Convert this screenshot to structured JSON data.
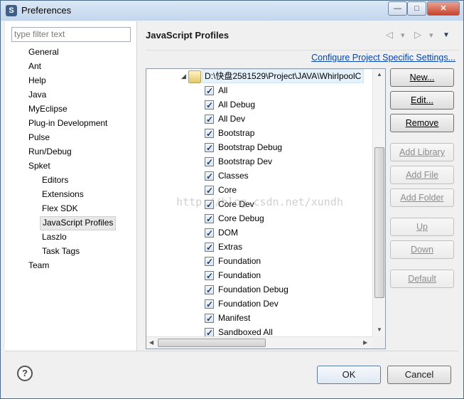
{
  "window": {
    "title": "Preferences",
    "controls": {
      "minimize": "—",
      "maximize": "□",
      "close": "✕"
    }
  },
  "filter": {
    "placeholder": "type filter text"
  },
  "nav": {
    "items": [
      {
        "label": "General",
        "level": 0
      },
      {
        "label": "Ant",
        "level": 0
      },
      {
        "label": "Help",
        "level": 0
      },
      {
        "label": "Java",
        "level": 0
      },
      {
        "label": "MyEclipse",
        "level": 0
      },
      {
        "label": "Plug-in Development",
        "level": 0
      },
      {
        "label": "Pulse",
        "level": 0
      },
      {
        "label": "Run/Debug",
        "level": 0
      },
      {
        "label": "Spket",
        "level": 0
      },
      {
        "label": "Editors",
        "level": 1
      },
      {
        "label": "Extensions",
        "level": 1
      },
      {
        "label": "Flex SDK",
        "level": 1
      },
      {
        "label": "JavaScript Profiles",
        "level": 1,
        "selected": true
      },
      {
        "label": "Laszlo",
        "level": 1
      },
      {
        "label": "Task Tags",
        "level": 1
      },
      {
        "label": "Team",
        "level": 0
      }
    ]
  },
  "page": {
    "title": "JavaScript Profiles",
    "configure_link": "Configure Project Specific Settings...",
    "nav_icons": {
      "back": "◁",
      "back_menu": "▾",
      "forward": "▷",
      "forward_menu": "▾",
      "view_menu": "▼"
    }
  },
  "tree": {
    "root": {
      "label": "D:\\快盘2581529\\Project\\JAVA\\WhirlpoolC",
      "icon": "folder-gear-icon",
      "expanded": true
    },
    "items": [
      {
        "label": "All",
        "checked": true
      },
      {
        "label": "All Debug",
        "checked": true
      },
      {
        "label": "All Dev",
        "checked": true
      },
      {
        "label": "Bootstrap",
        "checked": true
      },
      {
        "label": "Bootstrap Debug",
        "checked": true
      },
      {
        "label": "Bootstrap Dev",
        "checked": true
      },
      {
        "label": "Classes",
        "checked": true
      },
      {
        "label": "Core",
        "checked": true
      },
      {
        "label": "Core Dev",
        "checked": true
      },
      {
        "label": "Core Debug",
        "checked": true
      },
      {
        "label": "DOM",
        "checked": true
      },
      {
        "label": "Extras",
        "checked": true
      },
      {
        "label": "Foundation",
        "checked": true
      },
      {
        "label": "Foundation",
        "checked": true
      },
      {
        "label": "Foundation Debug",
        "checked": true
      },
      {
        "label": "Foundation Dev",
        "checked": true
      },
      {
        "label": "Manifest",
        "checked": true
      },
      {
        "label": "Sandboxed All",
        "checked": true
      }
    ]
  },
  "buttons": {
    "new": "New...",
    "edit": "Edit...",
    "remove": "Remove",
    "add_library": "Add Library",
    "add_file": "Add File",
    "add_folder": "Add Folder",
    "up": "Up",
    "down": "Down",
    "default": "Default"
  },
  "watermark": "http://blog.csdn.net/xundh",
  "footer": {
    "help": "?",
    "ok": "OK",
    "cancel": "Cancel"
  }
}
